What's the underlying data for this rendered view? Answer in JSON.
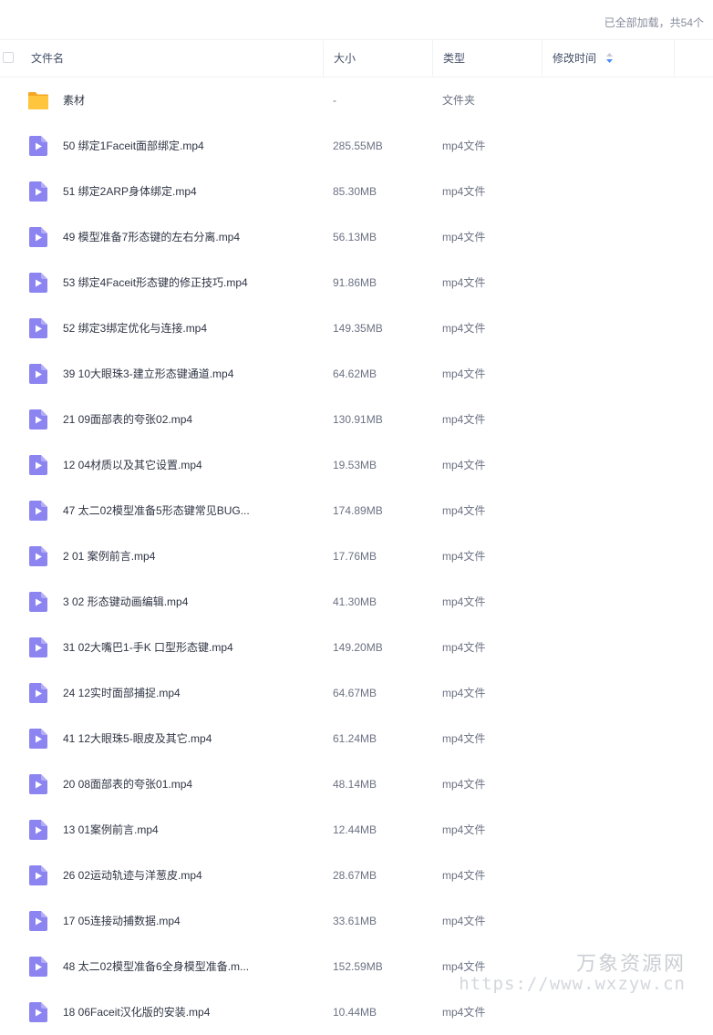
{
  "status": {
    "loaded_text": "已全部加载，共54个"
  },
  "header": {
    "name": "文件名",
    "size": "大小",
    "type": "类型",
    "modified": "修改时间"
  },
  "files": [
    {
      "kind": "folder",
      "name": "素材",
      "size": "-",
      "type": "文件夹"
    },
    {
      "kind": "video",
      "name": "50 绑定1Faceit面部绑定.mp4",
      "size": "285.55MB",
      "type": "mp4文件"
    },
    {
      "kind": "video",
      "name": "51 绑定2ARP身体绑定.mp4",
      "size": "85.30MB",
      "type": "mp4文件"
    },
    {
      "kind": "video",
      "name": "49 模型准备7形态键的左右分离.mp4",
      "size": "56.13MB",
      "type": "mp4文件"
    },
    {
      "kind": "video",
      "name": "53 绑定4Faceit形态键的修正技巧.mp4",
      "size": "91.86MB",
      "type": "mp4文件"
    },
    {
      "kind": "video",
      "name": "52 绑定3绑定优化与连接.mp4",
      "size": "149.35MB",
      "type": "mp4文件"
    },
    {
      "kind": "video",
      "name": "39 10大眼珠3-建立形态键通道.mp4",
      "size": "64.62MB",
      "type": "mp4文件"
    },
    {
      "kind": "video",
      "name": "21 09面部表的夸张02.mp4",
      "size": "130.91MB",
      "type": "mp4文件"
    },
    {
      "kind": "video",
      "name": "12 04材质以及其它设置.mp4",
      "size": "19.53MB",
      "type": "mp4文件"
    },
    {
      "kind": "video",
      "name": "47 太二02模型准备5形态键常见BUG...",
      "size": "174.89MB",
      "type": "mp4文件"
    },
    {
      "kind": "video",
      "name": "2 01 案例前言.mp4",
      "size": "17.76MB",
      "type": "mp4文件"
    },
    {
      "kind": "video",
      "name": "3 02 形态键动画编辑.mp4",
      "size": "41.30MB",
      "type": "mp4文件"
    },
    {
      "kind": "video",
      "name": "31 02大嘴巴1-手K 口型形态键.mp4",
      "size": "149.20MB",
      "type": "mp4文件"
    },
    {
      "kind": "video",
      "name": "24 12实时面部捕捉.mp4",
      "size": "64.67MB",
      "type": "mp4文件"
    },
    {
      "kind": "video",
      "name": "41 12大眼珠5-眼皮及其它.mp4",
      "size": "61.24MB",
      "type": "mp4文件"
    },
    {
      "kind": "video",
      "name": "20 08面部表的夸张01.mp4",
      "size": "48.14MB",
      "type": "mp4文件"
    },
    {
      "kind": "video",
      "name": "13 01案例前言.mp4",
      "size": "12.44MB",
      "type": "mp4文件"
    },
    {
      "kind": "video",
      "name": "26 02运动轨迹与洋葱皮.mp4",
      "size": "28.67MB",
      "type": "mp4文件"
    },
    {
      "kind": "video",
      "name": "17 05连接动捕数据.mp4",
      "size": "33.61MB",
      "type": "mp4文件"
    },
    {
      "kind": "video",
      "name": "48 太二02模型准备6全身模型准备.m...",
      "size": "152.59MB",
      "type": "mp4文件"
    },
    {
      "kind": "video",
      "name": "18 06Faceit汉化版的安装.mp4",
      "size": "10.44MB",
      "type": "mp4文件"
    }
  ],
  "watermark": {
    "name": "万象资源网",
    "url": "https://www.wxzyw.cn"
  },
  "colors": {
    "folder": "#ffc53d",
    "folder_dark": "#f5a623",
    "video": "#8c84f0",
    "sort_active": "#4a8cf7",
    "sort_inactive": "#c4c8d2"
  }
}
